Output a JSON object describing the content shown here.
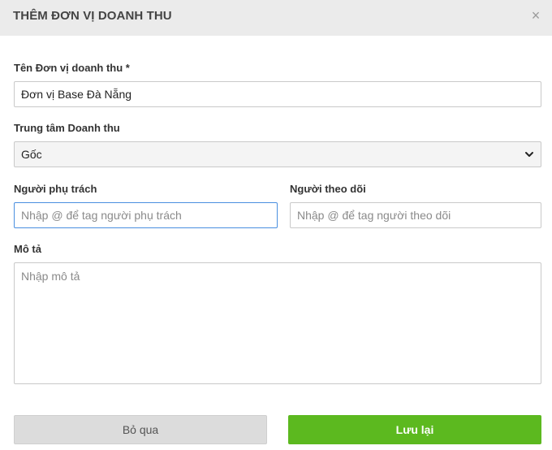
{
  "dialog": {
    "title": "THÊM ĐƠN VỊ DOANH THU",
    "close_symbol": "×"
  },
  "form": {
    "unit_name": {
      "label": "Tên Đơn vị doanh thu *",
      "value": "Đơn vị Base Đà Nẵng"
    },
    "revenue_center": {
      "label": "Trung tâm Doanh thu",
      "selected": "Gốc"
    },
    "assignee": {
      "label": "Người phụ trách",
      "placeholder": "Nhập @ để tag người phụ trách"
    },
    "follower": {
      "label": "Người theo dõi",
      "placeholder": "Nhập @ để tag người theo dõi"
    },
    "description": {
      "label": "Mô tả",
      "placeholder": "Nhập mô tả"
    }
  },
  "actions": {
    "cancel_label": "Bỏ qua",
    "save_label": "Lưu lại"
  },
  "colors": {
    "save_button": "#5cb91f",
    "cancel_button": "#dcdcdc",
    "header_bg": "#ebebeb",
    "focus_border": "#4a8fe0"
  },
  "icons": {
    "close": "close-icon",
    "select_arrow": "chevron-down-icon"
  }
}
